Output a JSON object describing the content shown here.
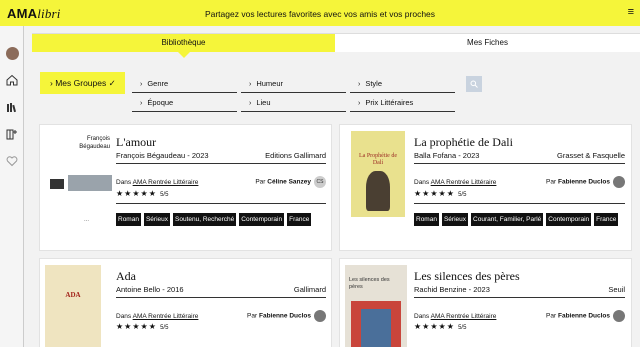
{
  "header": {
    "logo_bold": "AMA",
    "logo_italic": "libri",
    "tagline": "Partagez vos lectures favorites avec vos amis et vos proches",
    "menu_icon": "hamburger-icon"
  },
  "sidebar": {
    "icons": [
      "avatar",
      "home-icon",
      "library-icon",
      "add-book-icon",
      "heart-icon"
    ]
  },
  "tabs": [
    {
      "label": "Bibliothèque"
    },
    {
      "label": "Mes Fiches"
    }
  ],
  "filters": {
    "groups_label": "Mes Groupes",
    "items": [
      "Genre",
      "Humeur",
      "Style",
      "Époque",
      "Lieu",
      "Prix Littéraires"
    ]
  },
  "books": [
    {
      "title": "L'amour",
      "author_year": "François Bégaudeau - 2023",
      "publisher": "Editions Gallimard",
      "cover_text": "François Bégaudeau",
      "dans_prefix": "Dans",
      "group": "AMA Rentrée Littéraire",
      "par_prefix": "Par",
      "by": "Céline Sanzey",
      "by_initials": "CS",
      "stars": "★★★★★",
      "rating": "5/5",
      "tags": [
        "Roman",
        "Sérieux",
        "Soutenu, Recherché",
        "Contemporain",
        "France"
      ]
    },
    {
      "title": "La prophétie de Dali",
      "author_year": "Balla Fofana - 2023",
      "publisher": "Grasset & Fasquelle",
      "cover_text": "La Prophétie de Dalí",
      "dans_prefix": "Dans",
      "group": "AMA Rentrée Littéraire",
      "par_prefix": "Par",
      "by": "Fabienne Duclos",
      "stars": "★★★★★",
      "rating": "5/5",
      "tags": [
        "Roman",
        "Sérieux",
        "Courant, Familier, Parlé",
        "Contemporain",
        "France"
      ]
    },
    {
      "title": "Ada",
      "author_year": "Antoine Bello - 2016",
      "publisher": "Gallimard",
      "cover_text": "ADA",
      "dans_prefix": "Dans",
      "group": "AMA Rentrée Littéraire",
      "par_prefix": "Par",
      "by": "Fabienne Duclos",
      "stars": "★★★★★",
      "rating": "5/5"
    },
    {
      "title": "Les silences des pères",
      "author_year": "Rachid Benzine - 2023",
      "publisher": "Seuil",
      "cover_text": "Les silences des pères",
      "dans_prefix": "Dans",
      "group": "AMA Rentrée Littéraire",
      "par_prefix": "Par",
      "by": "Fabienne Duclos",
      "stars": "★★★★★",
      "rating": "5/5"
    }
  ],
  "colors": {
    "accent": "#f5f53a",
    "tag_bg": "#111111"
  }
}
